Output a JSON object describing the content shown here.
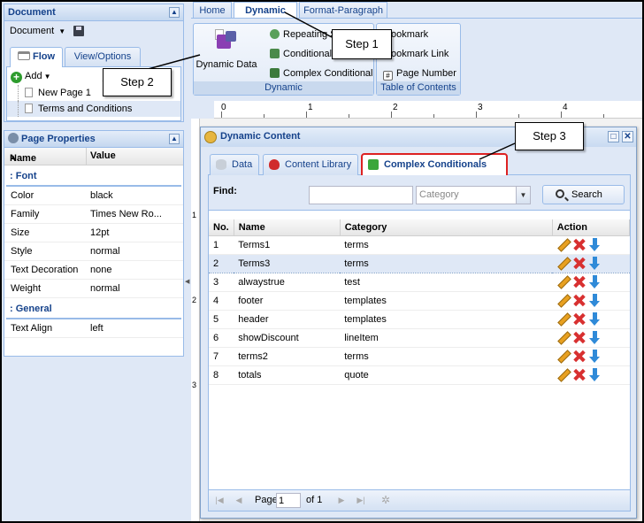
{
  "document_panel": {
    "title": "Document",
    "menu_label": "Document",
    "tabs": [
      {
        "label": "Flow"
      },
      {
        "label": "View/Options"
      }
    ],
    "add_label": "Add",
    "pages": [
      {
        "label": "New Page 1"
      },
      {
        "label": "Terms and Conditions"
      }
    ]
  },
  "properties_panel": {
    "title": "Page Properties",
    "col_name": "Name",
    "col_value": "Value",
    "groups": [
      {
        "label": ": Font",
        "rows": [
          {
            "name": "Color",
            "value": "black"
          },
          {
            "name": "Family",
            "value": "Times New Ro..."
          },
          {
            "name": "Size",
            "value": "12pt"
          },
          {
            "name": "Style",
            "value": "normal"
          },
          {
            "name": "Text Decoration",
            "value": "none"
          },
          {
            "name": "Weight",
            "value": "normal"
          }
        ]
      },
      {
        "label": ": General",
        "rows": [
          {
            "name": "Text Align",
            "value": "left"
          }
        ]
      }
    ]
  },
  "ribbon": {
    "tabs": [
      {
        "label": "Home"
      },
      {
        "label": "Dynamic"
      },
      {
        "label": "Format-Paragraph"
      }
    ],
    "dynamic_group": {
      "label": "Dynamic",
      "big_button": "Dynamic Data",
      "buttons": [
        {
          "label": "Repeating S"
        },
        {
          "label": "Conditional"
        },
        {
          "label": "Complex Conditional"
        }
      ]
    },
    "toc_group": {
      "label": "Table of Contents",
      "buttons": [
        {
          "label": "ookmark"
        },
        {
          "label": "ookmark Link"
        },
        {
          "label": "Page Number"
        }
      ]
    }
  },
  "ruler": {
    "numbers": [
      "0",
      "1",
      "2",
      "3",
      "4"
    ],
    "vertical_numbers": [
      "1",
      "2",
      "3"
    ]
  },
  "dialog": {
    "title": "Dynamic Content",
    "tabs": [
      {
        "label": "Data"
      },
      {
        "label": "Content Library"
      },
      {
        "label": "Complex Conditionals"
      }
    ],
    "find_label": "Find:",
    "find_value": "",
    "category_placeholder": "Category",
    "search_label": "Search",
    "columns": [
      "No.",
      "Name",
      "Category",
      "Action"
    ],
    "rows": [
      {
        "no": "1",
        "name": "Terms1",
        "category": "terms"
      },
      {
        "no": "2",
        "name": "Terms3",
        "category": "terms"
      },
      {
        "no": "3",
        "name": "alwaystrue",
        "category": "test"
      },
      {
        "no": "4",
        "name": "footer",
        "category": "templates"
      },
      {
        "no": "5",
        "name": "header",
        "category": "templates"
      },
      {
        "no": "6",
        "name": "showDiscount",
        "category": "lineItem"
      },
      {
        "no": "7",
        "name": "terms2",
        "category": "terms"
      },
      {
        "no": "8",
        "name": "totals",
        "category": "quote"
      }
    ],
    "pager": {
      "page_label": "Page",
      "page_value": "1",
      "of_label": "of 1"
    }
  },
  "callouts": {
    "step1": "Step 1",
    "step2": "Step 2",
    "step3": "Step 3"
  },
  "colors": {
    "accent": "#15428b",
    "panel_bg": "#dfe8f6",
    "border": "#99bbe8",
    "highlight": "#d22222"
  }
}
